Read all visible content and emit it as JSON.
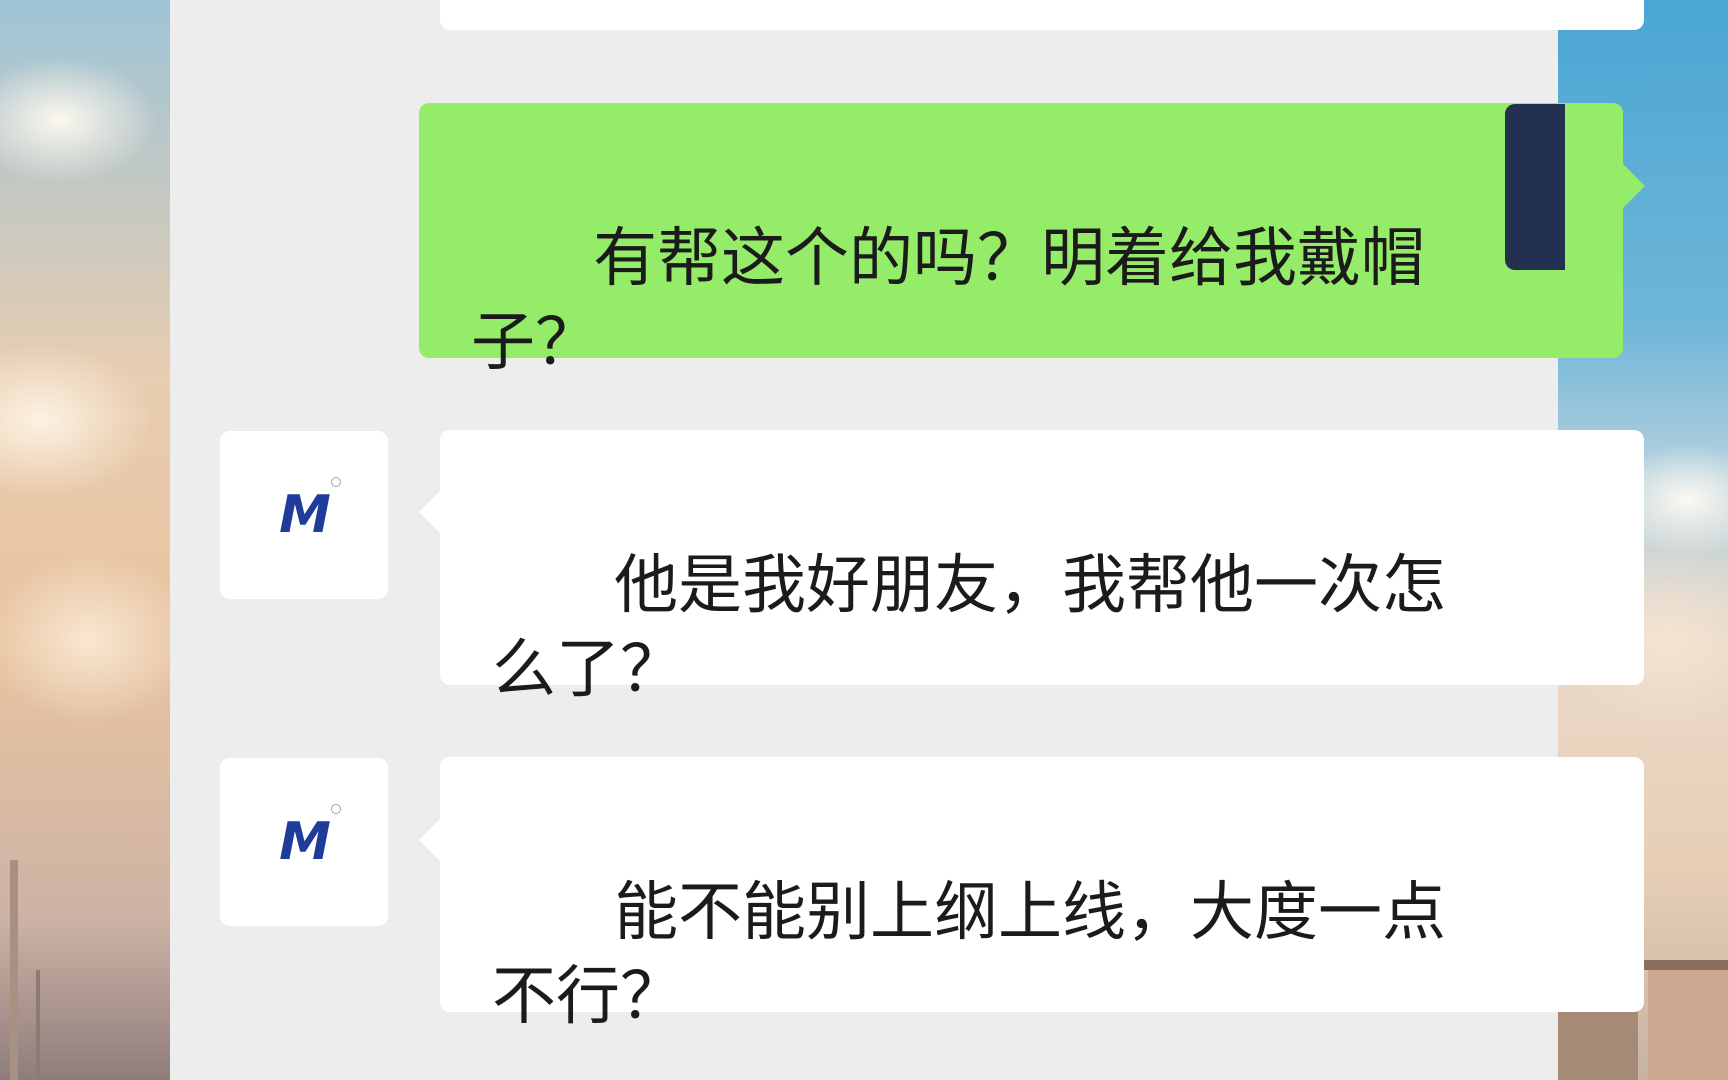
{
  "chat": {
    "messages": [
      {
        "side": "left",
        "text": ""
      },
      {
        "side": "right",
        "text": "有帮这个的吗？明着给我戴帽\n子？"
      },
      {
        "side": "left",
        "text": "他是我好朋友，我帮他一次怎\n么了？",
        "avatar_logo": "M"
      },
      {
        "side": "left",
        "text": "能不能别上纲上线，大度一点\n不行？",
        "avatar_logo": "M"
      }
    ]
  },
  "colors": {
    "chat_background": "#ededed",
    "sent_bubble": "#95ec69",
    "received_bubble": "#ffffff",
    "logo": "#1f3c9a"
  }
}
